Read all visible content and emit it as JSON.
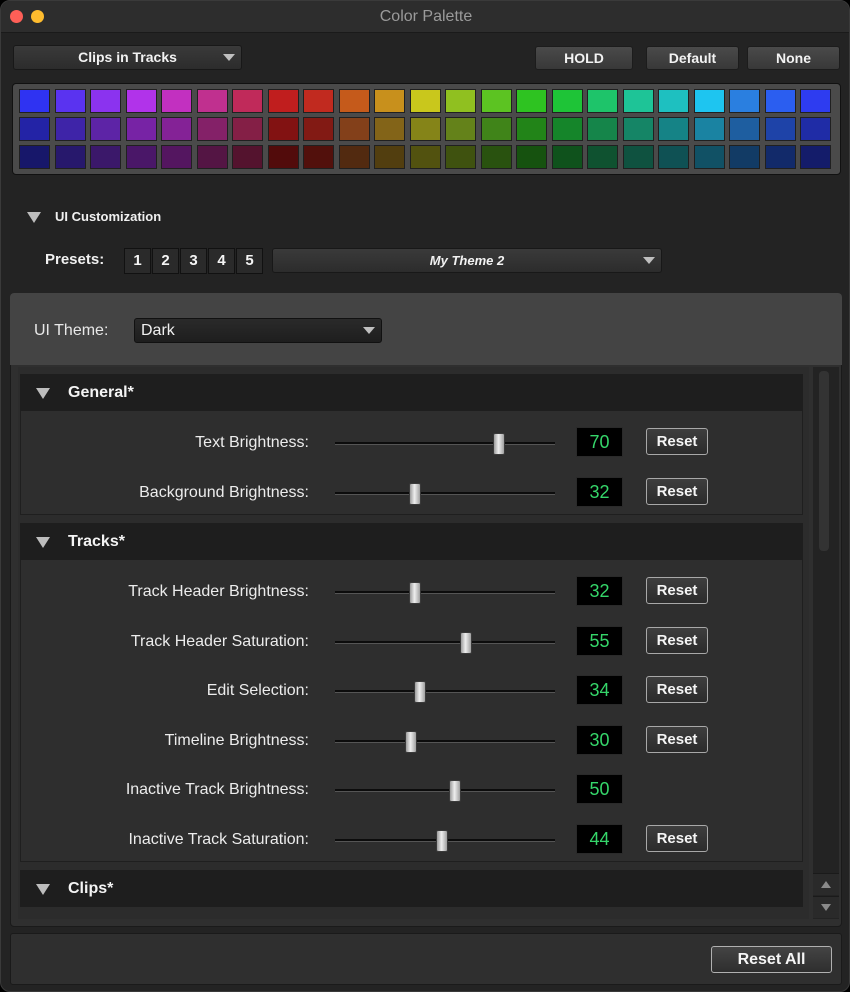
{
  "window": {
    "title": "Color Palette"
  },
  "top": {
    "mode_dropdown": "Clips in Tracks",
    "buttons": [
      "HOLD",
      "Default",
      "None"
    ]
  },
  "palette": {
    "rows": [
      [
        "#2f33f2",
        "#5a33f0",
        "#8b33ef",
        "#b133ea",
        "#c230c0",
        "#c0308f",
        "#c02a5a",
        "#c01e1e",
        "#c12a1f",
        "#c55a1b",
        "#c8901c",
        "#c9c71c",
        "#90c020",
        "#5cc322",
        "#2ec321",
        "#1ec437",
        "#1ec46a",
        "#1ec497",
        "#1ec0c0",
        "#1ec5f0",
        "#2a7fe0",
        "#2b5ef0",
        "#2e3cf0"
      ],
      [
        "#2323a6",
        "#3e24a8",
        "#5d24a6",
        "#7723a5",
        "#842296",
        "#842168",
        "#841f46",
        "#821212",
        "#821a14",
        "#83401a",
        "#836418",
        "#858418",
        "#64821a",
        "#408419",
        "#228418",
        "#15852a",
        "#15854a",
        "#158566",
        "#158386",
        "#1a83a2",
        "#1e5ea0",
        "#1e43a8",
        "#1f2ca6"
      ],
      [
        "#17176a",
        "#27186c",
        "#3b186a",
        "#4a1768",
        "#541660",
        "#541544",
        "#54132e",
        "#520b0b",
        "#52100c",
        "#522a10",
        "#523e0f",
        "#52520f",
        "#3f520f",
        "#29520f",
        "#16520f",
        "#0f521c",
        "#0f5230",
        "#0f5240",
        "#0f5154",
        "#115165",
        "#123b65",
        "#122a6a",
        "#141c6a"
      ]
    ]
  },
  "ui_customization": {
    "label": "UI Customization",
    "presets_label": "Presets:",
    "presets": [
      "1",
      "2",
      "3",
      "4",
      "5"
    ],
    "theme_preset": "My Theme 2"
  },
  "theme": {
    "label": "UI Theme:",
    "value": "Dark"
  },
  "sections": {
    "general": {
      "title": "General*",
      "rows": [
        {
          "label": "Text Brightness:",
          "value": "70",
          "level": 70,
          "reset": "Reset"
        },
        {
          "label": "Background Brightness:",
          "value": "32",
          "level": 32,
          "reset": "Reset"
        }
      ]
    },
    "tracks": {
      "title": "Tracks*",
      "rows": [
        {
          "label": "Track Header Brightness:",
          "value": "32",
          "level": 32,
          "reset": "Reset"
        },
        {
          "label": "Track Header Saturation:",
          "value": "55",
          "level": 55,
          "reset": "Reset"
        },
        {
          "label": "Edit Selection:",
          "value": "34",
          "level": 34,
          "reset": "Reset"
        },
        {
          "label": "Timeline Brightness:",
          "value": "30",
          "level": 30,
          "reset": "Reset"
        },
        {
          "label": "Inactive Track Brightness:",
          "value": "50",
          "level": 50,
          "reset": ""
        },
        {
          "label": "Inactive Track Saturation:",
          "value": "44",
          "level": 44,
          "reset": "Reset"
        }
      ]
    },
    "clips": {
      "title": "Clips*"
    }
  },
  "footer": {
    "reset_all": "Reset All"
  }
}
